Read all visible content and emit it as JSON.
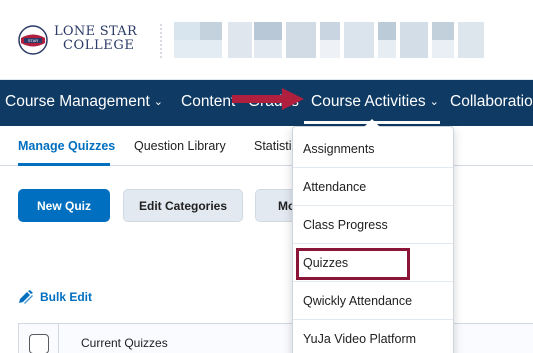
{
  "header": {
    "logo_line1": "LONE STAR",
    "logo_line2": "COLLEGE",
    "logo_badge": "STAR"
  },
  "nav": {
    "items": [
      {
        "label": "Course Management",
        "has_menu": true
      },
      {
        "label": "Content"
      },
      {
        "label": "Grades"
      },
      {
        "label": "Course Activities",
        "has_menu": true,
        "active": true
      },
      {
        "label": "Collaboration"
      }
    ],
    "chevron": "⌄"
  },
  "tabs": [
    "Manage Quizzes",
    "Question Library",
    "Statistics"
  ],
  "buttons": {
    "new_quiz": "New Quiz",
    "edit_categories": "Edit Categories",
    "more": "More Actions"
  },
  "bulk_edit": "Bulk Edit",
  "table": {
    "header_label": "Current Quizzes"
  },
  "dropdown": {
    "items": [
      "Assignments",
      "Attendance",
      "Class Progress",
      "Quizzes",
      "Qwickly Attendance",
      "YuJa Video Platform"
    ],
    "highlighted": "Quizzes"
  },
  "colors": {
    "navbar": "#0e3a63",
    "accent_blue": "#006fbf",
    "annotation_red": "#b01f3e",
    "highlight_border": "#8b1538"
  }
}
